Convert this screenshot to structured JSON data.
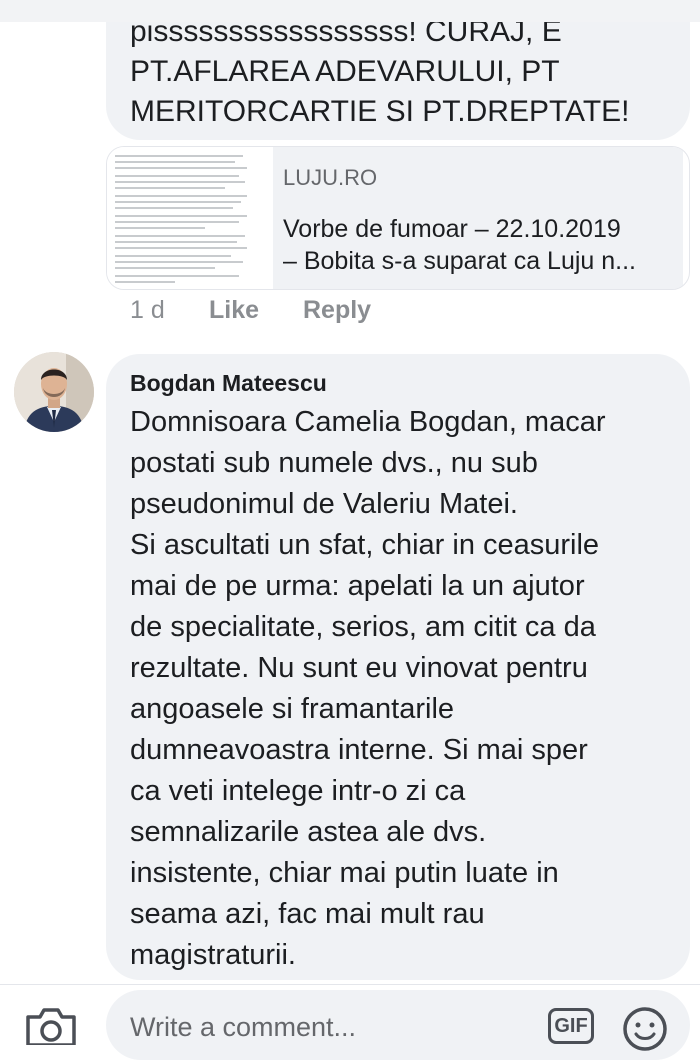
{
  "comment1": {
    "text": "pisssssssssssssssss! CURAJ, E\nPT.AFLAREA ADEVARULUI, PT\nMERITORCARTIE SI PT.DREPTATE!"
  },
  "link_preview": {
    "domain": "LUJU.RO",
    "title_line1": "Vorbe de fumoar – 22.10.2019",
    "title_line2": "– Bobita s-a suparat ca Luju n..."
  },
  "comment1_actions": {
    "time": "1 d",
    "like": "Like",
    "reply": "Reply"
  },
  "comment2": {
    "author": "Bogdan Mateescu",
    "lines": [
      "Domnisoara Camelia Bogdan, macar",
      "postati sub numele dvs., nu sub",
      "pseudonimul de Valeriu Matei.",
      "Si ascultati un sfat, chiar in ceasurile",
      "mai de pe urma: apelati la un ajutor",
      "de specialitate, serios, am citit ca da",
      "rezultate. Nu sunt eu vinovat  pentru",
      "angoasele si framantarile",
      "dumneavoastra interne. Si mai sper",
      "ca veti intelege intr-o zi ca",
      "semnalizarile astea ale dvs.",
      "insistente, chiar mai putin luate in",
      "seama azi, fac mai mult rau",
      "magistraturii."
    ]
  },
  "composer": {
    "placeholder": "Write a comment...",
    "gif_label": "GIF",
    "camera_icon": "camera-icon",
    "emoji_icon": "emoji-icon"
  }
}
